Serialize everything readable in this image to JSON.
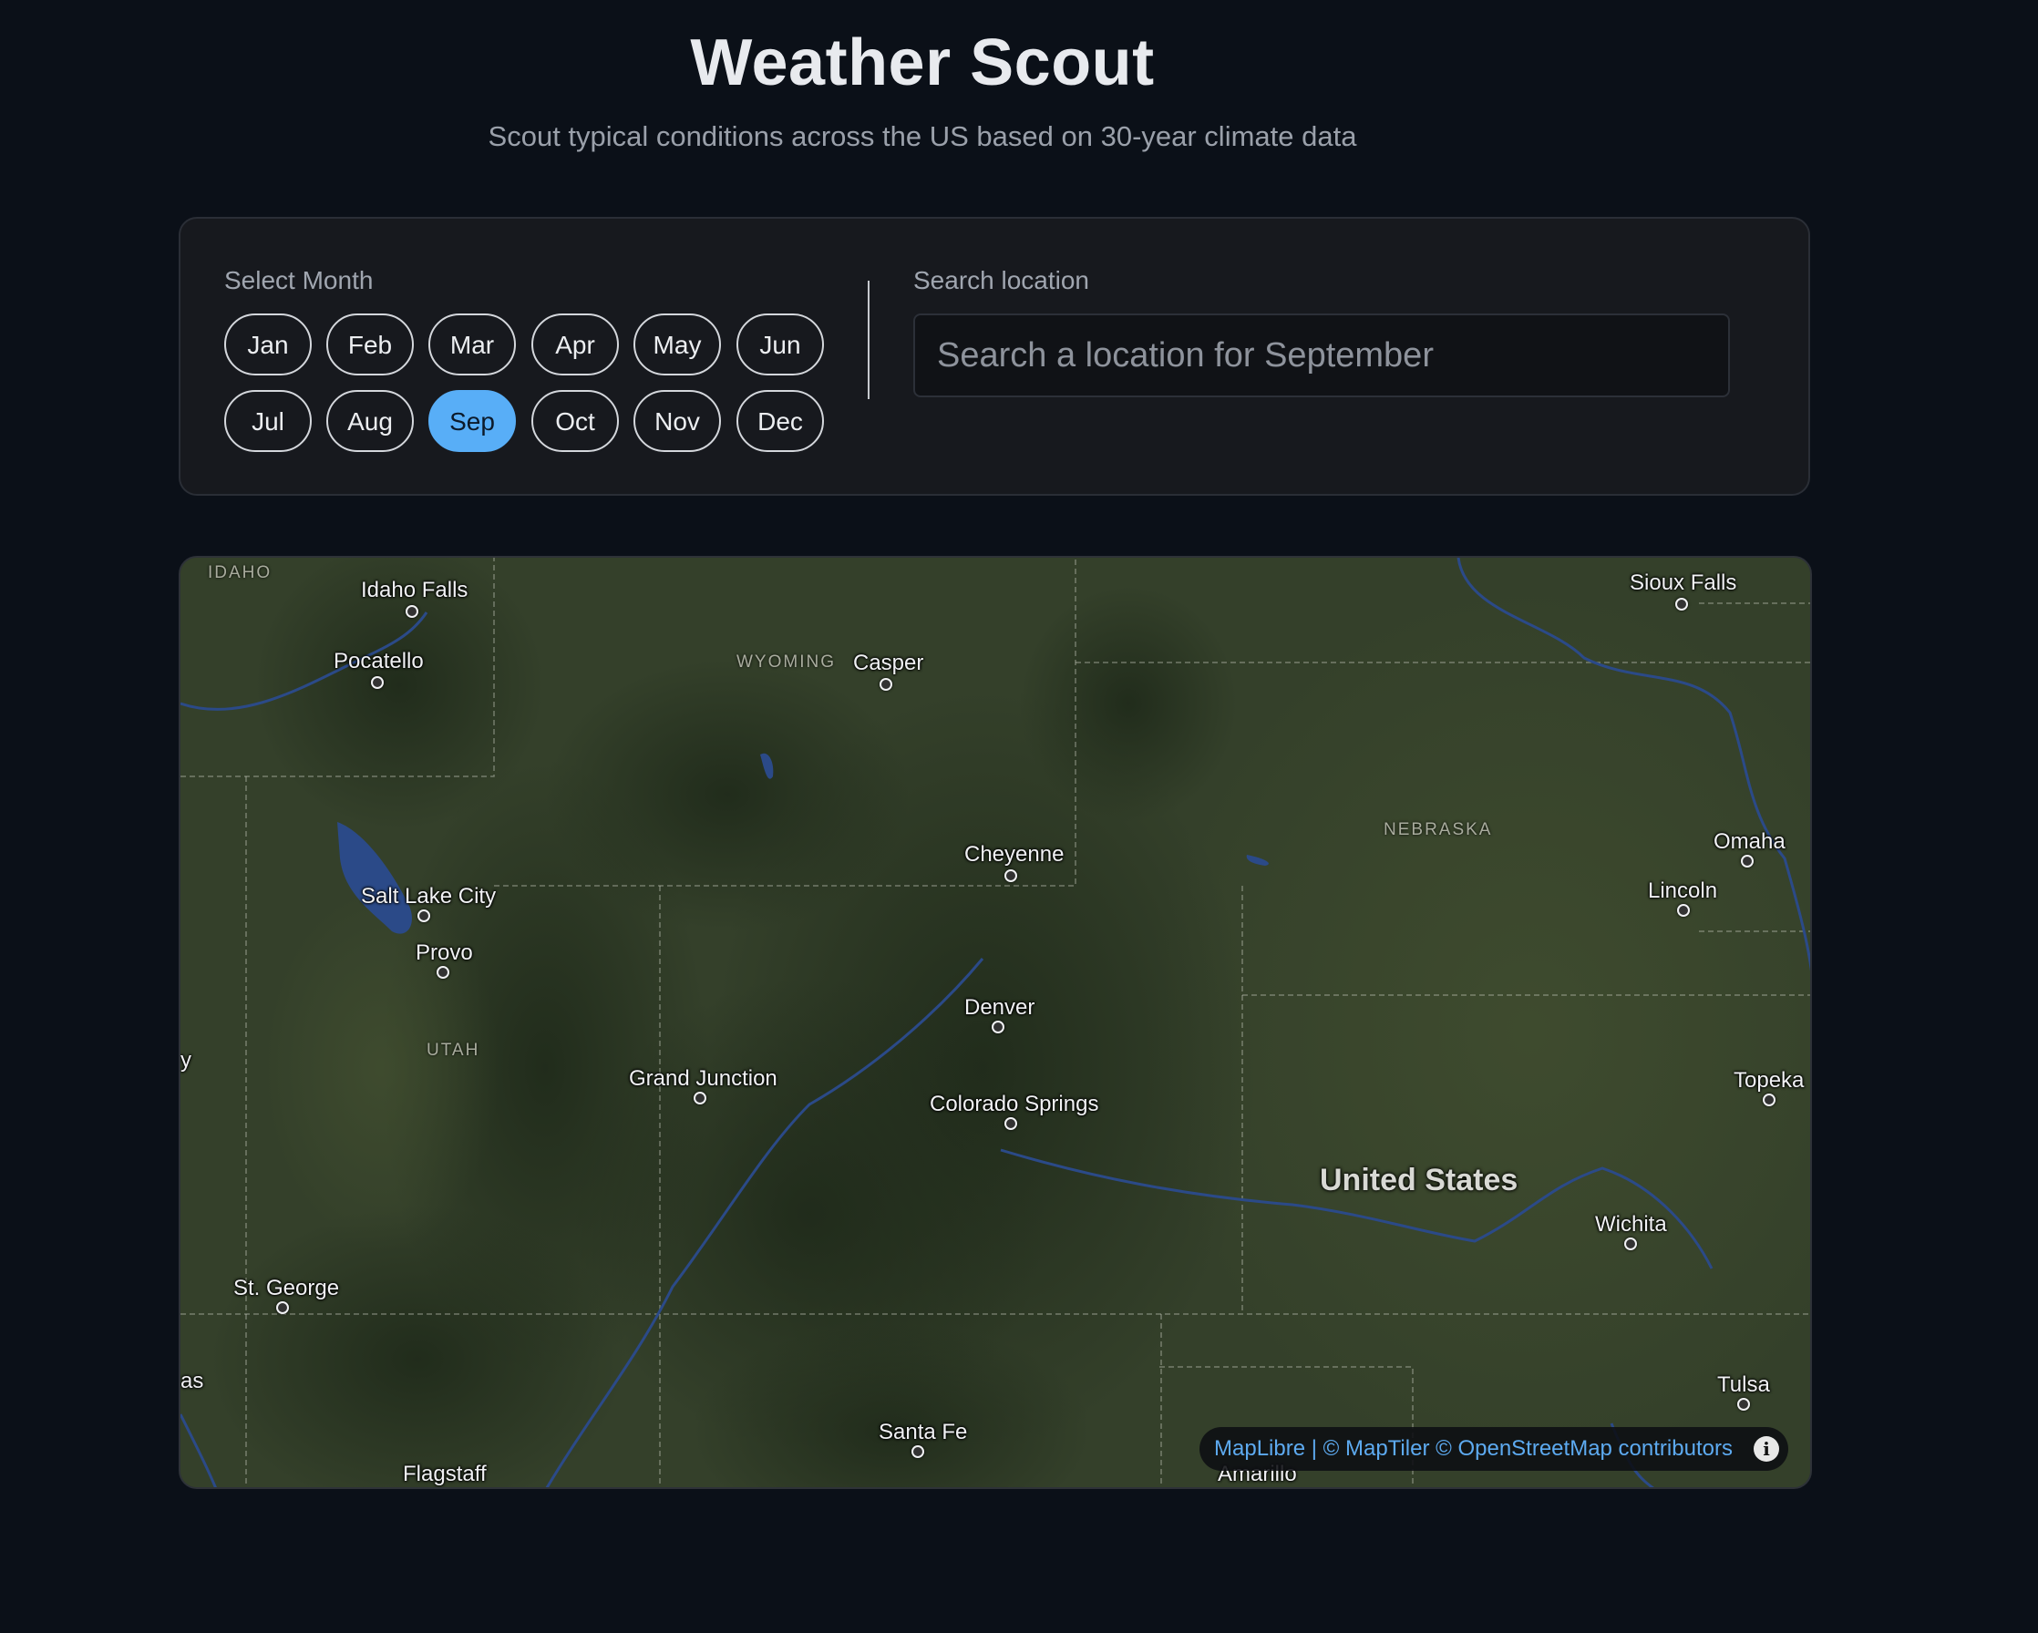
{
  "app": {
    "title": "Weather Scout",
    "subtitle": "Scout typical conditions across the US based on 30-year climate data"
  },
  "controls": {
    "month_label": "Select Month",
    "months": [
      "Jan",
      "Feb",
      "Mar",
      "Apr",
      "May",
      "Jun",
      "Jul",
      "Aug",
      "Sep",
      "Oct",
      "Nov",
      "Dec"
    ],
    "selected_month": "Sep",
    "search_label": "Search location",
    "search_placeholder": "Search a location for September",
    "search_value": ""
  },
  "map": {
    "states": [
      "IDAHO",
      "WYOMING",
      "NEBRASKA",
      "UTAH"
    ],
    "country": "United States",
    "cities": [
      "Idaho Falls",
      "Pocatello",
      "Casper",
      "Sioux Falls",
      "Cheyenne",
      "Omaha",
      "Lincoln",
      "Salt Lake City",
      "Provo",
      "Denver",
      "Grand Junction",
      "Colorado Springs",
      "Topeka",
      "Wichita",
      "St. George",
      "Tulsa",
      "Santa Fe",
      "Flagstaff",
      "Amarillo"
    ],
    "edge_labels": [
      "y",
      "as"
    ],
    "attribution": "MapLibre | © MapTiler © OpenStreetMap contributors",
    "info_icon": "info-icon",
    "colors": {
      "land": "#34402a",
      "forest": "#253120",
      "water": "#2b4a88",
      "selected_month": "#58aef7"
    }
  }
}
